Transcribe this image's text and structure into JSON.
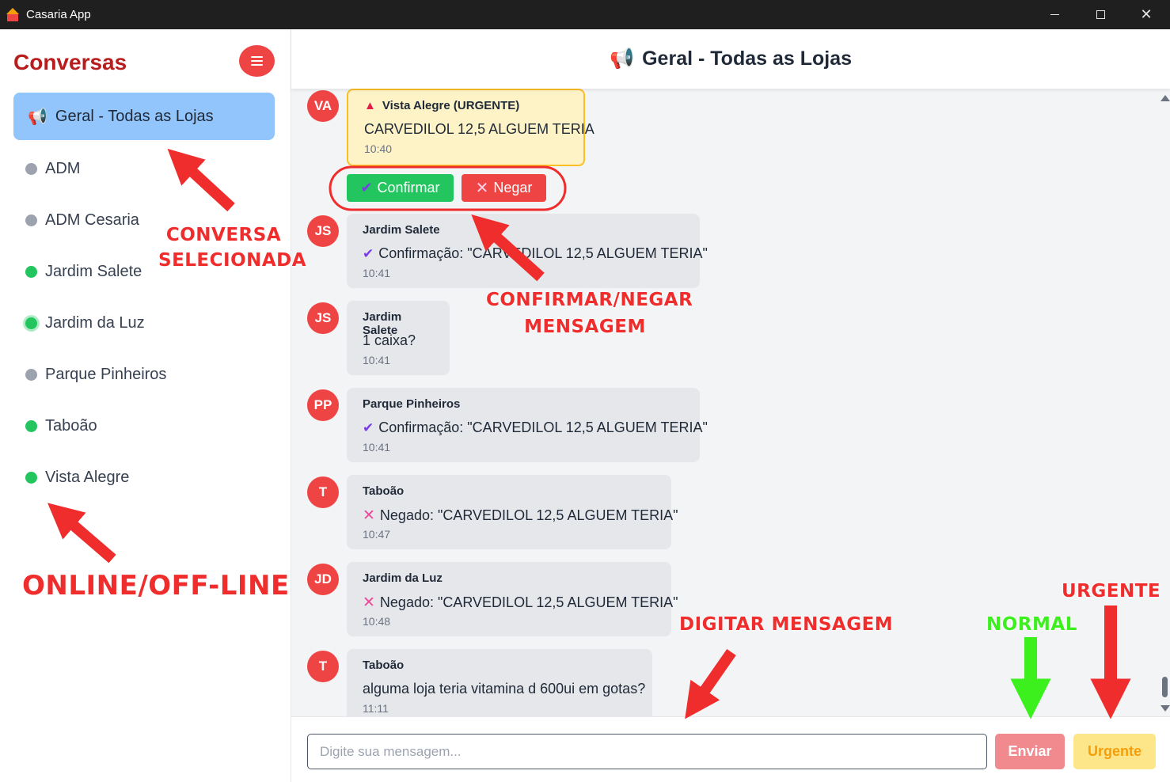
{
  "window": {
    "title": "Casaria App",
    "controls": {
      "minimize": "minimize",
      "maximize": "maximize",
      "close": "✕"
    }
  },
  "sidebar": {
    "title": "Conversas",
    "active": {
      "icon": "📢",
      "label": "Geral - Todas as Lojas"
    },
    "items": [
      {
        "label": "ADM",
        "status": "offline"
      },
      {
        "label": "ADM Cesaria",
        "status": "offline"
      },
      {
        "label": "Jardim Salete",
        "status": "online"
      },
      {
        "label": "Jardim da Luz",
        "status": "online"
      },
      {
        "label": "Parque Pinheiros",
        "status": "offline"
      },
      {
        "label": "Taboão",
        "status": "online"
      },
      {
        "label": "Vista Alegre",
        "status": "online"
      }
    ]
  },
  "header": {
    "icon": "📢",
    "title": "Geral - Todas as Lojas"
  },
  "messages": [
    {
      "initials": "VA",
      "sender": "Vista Alegre (URGENTE)",
      "text": "CARVEDILOL 12,5 ALGUEM TERIA",
      "time": "10:40",
      "urgent": true
    },
    {
      "initials": "JS",
      "sender": "Jardim Salete",
      "text": "Confirmação: \"CARVEDILOL 12,5 ALGUEM TERIA\"",
      "time": "10:41",
      "icon": "check"
    },
    {
      "initials": "JS",
      "sender": "Jardim Salete",
      "text": "1 caixa?",
      "time": "10:41"
    },
    {
      "initials": "PP",
      "sender": "Parque Pinheiros",
      "text": "Confirmação: \"CARVEDILOL 12,5 ALGUEM TERIA\"",
      "time": "10:41",
      "icon": "check"
    },
    {
      "initials": "T",
      "sender": "Taboão",
      "text": "Negado: \"CARVEDILOL 12,5 ALGUEM TERIA\"",
      "time": "10:47",
      "icon": "cross"
    },
    {
      "initials": "JD",
      "sender": "Jardim da Luz",
      "text": "Negado: \"CARVEDILOL 12,5 ALGUEM TERIA\"",
      "time": "10:48",
      "icon": "cross"
    },
    {
      "initials": "T",
      "sender": "Taboão",
      "text": "alguma loja teria vitamina d 600ui em gotas?",
      "time": "11:11"
    }
  ],
  "actions": {
    "confirm": "Confirmar",
    "deny": "Negar"
  },
  "composer": {
    "placeholder": "Digite sua mensagem...",
    "send": "Enviar",
    "urgent": "Urgente"
  },
  "annotations": {
    "conversa_l1": "CONVERSA",
    "conversa_l2": "SELECIONADA",
    "confirmar_l1": "CONFIRMAR/NEGAR",
    "confirmar_l2": "MENSAGEM",
    "online": "ONLINE/OFF-LINE",
    "digitar": "DIGITAR MENSAGEM",
    "normal": "NORMAL",
    "urgente": "URGENTE"
  },
  "colors": {
    "accent": "#ef4444",
    "active_conversation": "#93c5fd",
    "online": "#22c55e",
    "offline": "#9ca3af",
    "urgent_bubble": "#fef3c7",
    "annotation_red": "#ef2d2d",
    "annotation_green": "#3cf01e"
  }
}
